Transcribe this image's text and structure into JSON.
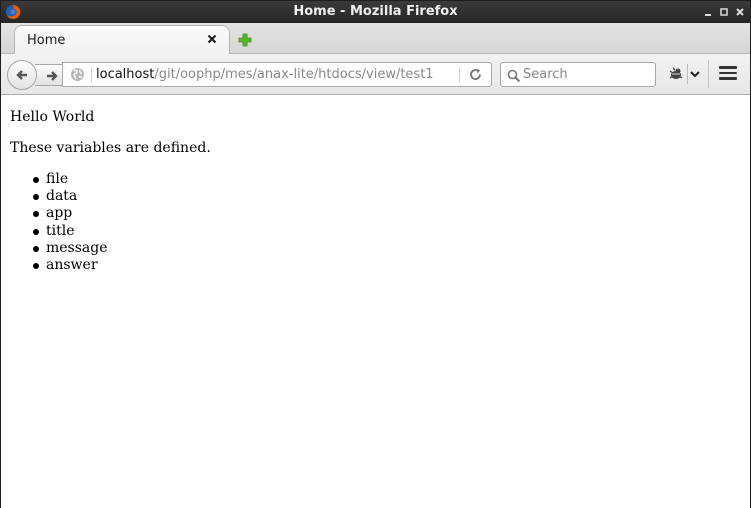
{
  "window": {
    "title": "Home - Mozilla Firefox"
  },
  "tabs": [
    {
      "label": "Home"
    }
  ],
  "navbar": {
    "url_host": "localhost",
    "url_path": "/git/oophp/mes/anax-lite/htdocs/view/test1",
    "search_placeholder": "Search"
  },
  "icons": {
    "app": "firefox-icon",
    "minimize": "minimize-icon",
    "maximize": "maximize-icon",
    "close": "close-icon",
    "tab_close": "close-icon",
    "new_tab": "plus-icon",
    "back": "arrow-left-icon",
    "forward": "arrow-right-icon",
    "site_identity": "globe-icon",
    "reload": "reload-icon",
    "search": "search-icon",
    "addon": "bug-icon",
    "dropdown": "chevron-down-icon",
    "menu": "hamburger-icon"
  },
  "page": {
    "greeting": "Hello World",
    "intro": "These variables are defined.",
    "variables": [
      "file",
      "data",
      "app",
      "title",
      "message",
      "answer"
    ]
  }
}
